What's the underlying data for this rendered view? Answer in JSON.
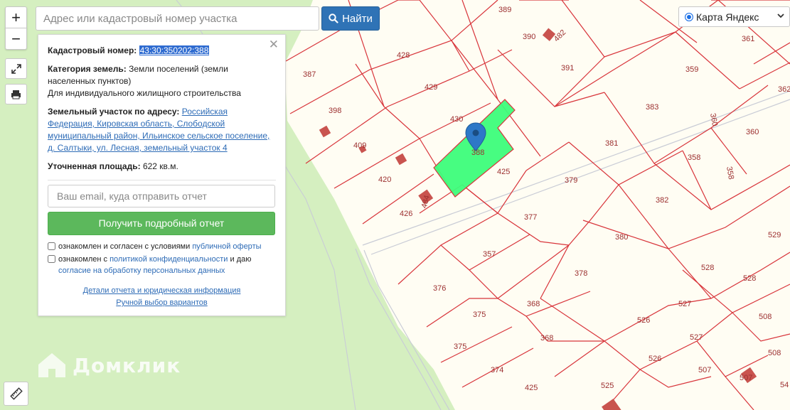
{
  "search": {
    "placeholder": "Адрес или кадастровый номер участка",
    "button_label": "Найти"
  },
  "zoom": {
    "plus": "+",
    "minus": "−"
  },
  "layer_select": {
    "selected": "Карта Яндекс"
  },
  "panel": {
    "cadastral_label": "Кадастровый номер:",
    "cadastral_value": "43:30:350202:388",
    "category_label": "Категория земель:",
    "category_value": "Земли поселений (земли населенных пунктов)",
    "category_use": "Для индивидуального жилищного строительства",
    "address_label": "Земельный участок по адресу:",
    "address_value": "Российская Федерация, Кировская область, Слободской муниципальный район, Ильинское сельское поселение, д. Салтыки, ул. Лесная, земельный участок 4",
    "area_label": "Уточненная площадь:",
    "area_value": "622 кв.м.",
    "email_placeholder": "Ваш email, куда отправить отчет",
    "report_button": "Получить подробный отчет",
    "agree1_prefix": "ознакомлен и согласен с условиями",
    "agree1_link": "публичной оферты",
    "agree2_prefix": "ознакомлен с",
    "agree2_link": "политикой конфиденциальности",
    "agree2_mid": "и даю",
    "agree2_link2": "согласие на обработку персональных данных",
    "details_link": "Детали отчета и юридическая информация",
    "manual_link": "Ручной выбор вариантов"
  },
  "watermark": "Домклик",
  "map": {
    "selected_plot_label": "388",
    "plot_labels": [
      "389",
      "390",
      "482",
      "391",
      "361",
      "387",
      "428",
      "429",
      "359",
      "362",
      "398",
      "430",
      "383",
      "360",
      "360",
      "409",
      "381",
      "358",
      "358",
      "420",
      "425",
      "379",
      "484",
      "426",
      "382",
      "377",
      "380",
      "529",
      "357",
      "378",
      "528",
      "528",
      "376",
      "368",
      "527",
      "375",
      "526",
      "527",
      "508",
      "375",
      "368",
      "526",
      "508",
      "374",
      "507",
      "507",
      "425",
      "525",
      "54"
    ]
  },
  "colors": {
    "plot_border": "#d8343a",
    "selected_plot": "#3dfd7a",
    "forest": "#d5efc0",
    "ground": "#fffdf3",
    "marker": "#2e78c7",
    "search_button": "#2f73b6",
    "report_button": "#5cb85c"
  }
}
